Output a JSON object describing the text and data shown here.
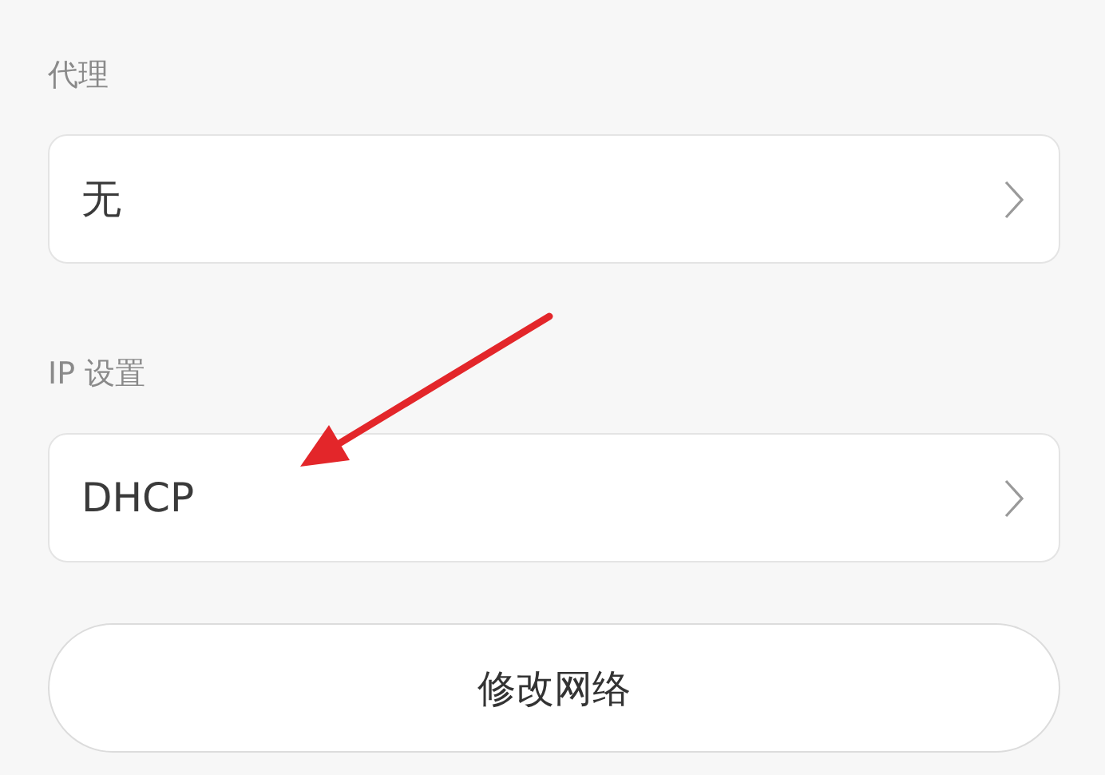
{
  "settings": [
    {
      "label": "代理",
      "value": "无"
    },
    {
      "label": "IP 设置",
      "value": "DHCP"
    }
  ],
  "button": {
    "label": "修改网络"
  }
}
